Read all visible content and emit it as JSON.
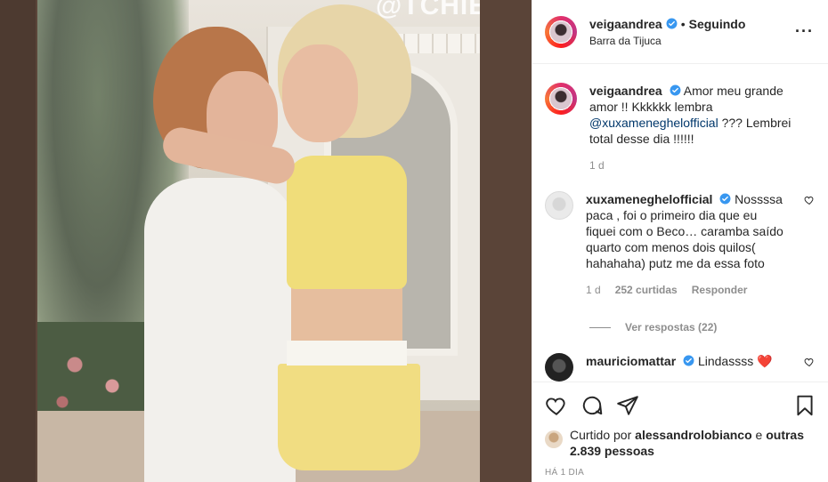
{
  "media": {
    "watermark": "@TCHIEX"
  },
  "header": {
    "username": "veigaandrea",
    "separator": "•",
    "following_label": "Seguindo",
    "location": "Barra da Tijuca",
    "more_icon": "more-horizontal-icon"
  },
  "caption": {
    "username": "veigaandrea",
    "text_before": "Amor meu grande amor !! Kkkkkk lembra ",
    "mention": "@xuxameneghelofficial",
    "text_after": " ??? Lembrei total desse dia !!!!!!",
    "time": "1 d"
  },
  "comments": [
    {
      "username": "xuxameneghelofficial",
      "text": "Nossssa paca , foi o primeiro dia que eu fiquei com o Beco… caramba saído quarto com menos dois quilos( hahahaha) putz me da essa foto",
      "time": "1 d",
      "likes": "252 curtidas",
      "reply_label": "Responder",
      "view_replies": "Ver respostas (22)"
    },
    {
      "username": "mauriciomattar",
      "text": "Lindassss ❤️"
    }
  ],
  "actions": {
    "like_icon": "heart-icon",
    "comment_icon": "comment-icon",
    "share_icon": "send-icon",
    "save_icon": "bookmark-icon"
  },
  "likes": {
    "prefix": "Curtido por ",
    "user": "alessandrolobianco",
    "middle": " e ",
    "others": "outras 2.839 pessoas"
  },
  "date": "HÁ 1 DIA",
  "colors": {
    "verified": "#3897f0",
    "text": "#262626",
    "secondary": "#8e8e8e",
    "mention": "#00376b",
    "heart_red": "#ed4956"
  }
}
